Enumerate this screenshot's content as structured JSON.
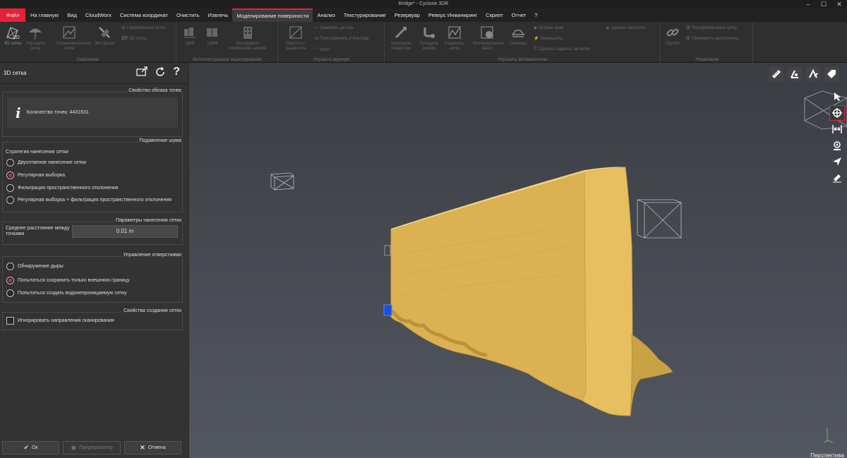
{
  "window": {
    "title": "Bridge* - Cyclone 3DR",
    "controls": [
      "–",
      "☐",
      "✕"
    ]
  },
  "menu": {
    "file": "Файл",
    "items": [
      "На главную",
      "Вид",
      "CloudWorx",
      "Система координат",
      "Очистить",
      "Извлечь",
      "Моделирование поверхности",
      "Анализ",
      "Текстурирование",
      "Резервуар",
      "Реверс Инжиниринг",
      "Скрипт",
      "Отчет",
      "?"
    ],
    "active_index": 6
  },
  "ribbon": {
    "groups": {
      "meshing": "Сцепление",
      "intelligent": "Интеллектуальное моделирование",
      "improve_manual": "Улучшить вручную",
      "improve_auto": "Улучшить автоматически",
      "manage": "Управление"
    },
    "buttons": {
      "mesh3d": "3D сетка",
      "smooth_mesh": "Улучшить сетку",
      "constrained_mesh": "Ограничительная сетка",
      "extrusion": "Экструзия",
      "spherical_mesh": "Сферическая сетка",
      "mesh2d": "2D сетка",
      "dtm": "ЦМР",
      "dem": "ЦММ",
      "building_tool": "Инструмент извлечения зданий",
      "clean_split": "Очистить / разделить",
      "replace_part": "Заменить деталь",
      "join_contours": "Присоединить 2 Контура",
      "bridge": "Мост",
      "fill_holes": "Заполнить отверстия",
      "smooth_cell": "Сгладить ячейку",
      "cut_mesh": "Разрезать сетку",
      "inspection_steps": "Инспекционные Шаги",
      "boundaries": "Границы",
      "sharp_edges": "Острые края",
      "reduce": "Уменьшить",
      "make_label": "Сделать надпись на сетке",
      "remove_spikes": "Удалить выступы",
      "group": "Группа",
      "ungroup": "Разгруппировать сетку",
      "check_integrity": "Проверить целостность"
    }
  },
  "panel": {
    "title": "3D сетка",
    "cloud_props": {
      "title": "Свойство облака точек",
      "count_label": "Количество точек: 4431631"
    },
    "noise": {
      "title": "Подавление шума",
      "strategy_label": "Стратегия нанесения сетки",
      "options": [
        "Двухэтапное нанесение сетки",
        "Регулярная выборка",
        "Фильтрация пространственного отклонения",
        "Регулярная выборка + фильтрация пространственного отклонения"
      ],
      "selected": 1
    },
    "params": {
      "title": "Параметры нанесения сетки",
      "distance_label": "Среднее расстояние между точками",
      "distance_value": "0.01 m"
    },
    "holes": {
      "title": "Управление отверстиями",
      "options": [
        "Обнаружение дыры",
        "Попытаться сохранить только внешнюю границу",
        "Попытаться создать водонепроницаемую сетку"
      ],
      "selected": 1
    },
    "creation": {
      "title": "Свойства создания сетки",
      "ignore_scan_label": "Игнорировать направления сканирования",
      "ignore_scan_checked": false
    },
    "buttons": {
      "ok": "Ок",
      "preview": "Предпросмотр",
      "cancel": "Отмена"
    }
  },
  "viewport": {
    "projection_label": "Перспектива",
    "mesh_color": "#e3b95a",
    "accent": "#e8213a"
  }
}
